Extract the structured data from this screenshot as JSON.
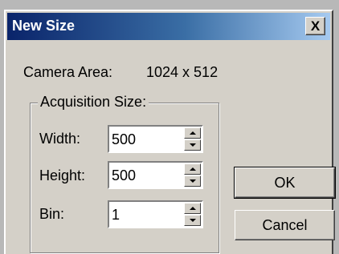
{
  "window": {
    "title": "New Size",
    "close_label": "X"
  },
  "info": {
    "camera_area_label": "Camera Area:",
    "camera_area_value": "1024 x 512"
  },
  "acquisition": {
    "group_label": "Acquisition Size:",
    "width_label": "Width:",
    "width_value": "500",
    "height_label": "Height:",
    "height_value": "500",
    "bin_label": "Bin:",
    "bin_value": "1"
  },
  "buttons": {
    "ok_label": "OK",
    "cancel_label": "Cancel"
  },
  "colors": {
    "title_gradient_start": "#0a246a",
    "title_gradient_end": "#a6caf0",
    "dialog_face": "#d4d0c8"
  }
}
